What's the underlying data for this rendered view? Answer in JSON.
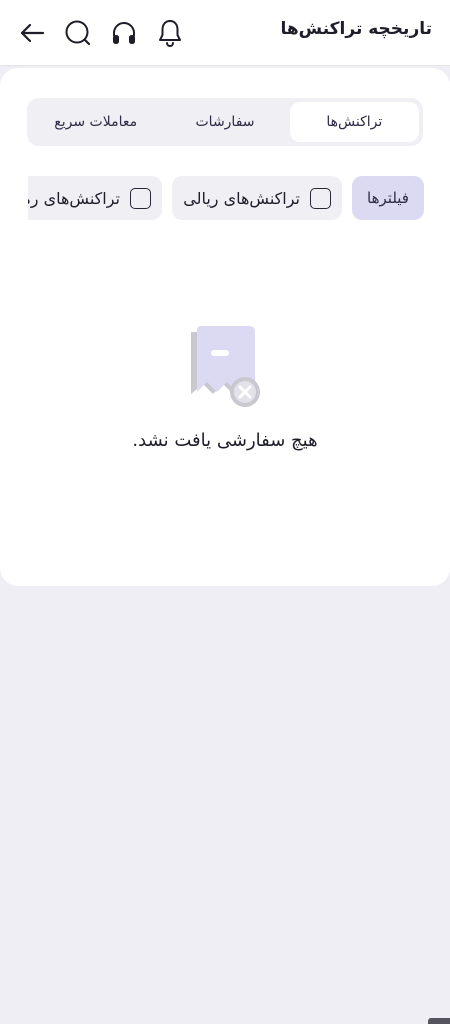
{
  "header": {
    "title": "تاریخچه تراکنش‌ها",
    "icons": [
      "back-arrow-icon",
      "search-icon",
      "headphones-icon",
      "bell-icon"
    ]
  },
  "tabs": [
    {
      "label": "تراکنش‌ها",
      "active": true
    },
    {
      "label": "سفارشات",
      "active": false
    },
    {
      "label": "معاملات سریع",
      "active": false
    }
  ],
  "filters": {
    "label": "فیلترها",
    "options": [
      {
        "label": "تراکنش‌های ریالی",
        "checked": false
      },
      {
        "label": "تراکنش‌های رمزارزی",
        "checked": false
      }
    ]
  },
  "empty_state": {
    "icon": "empty-receipt-icon",
    "message": "هیچ سفارشی یافت نشد."
  },
  "colors": {
    "background": "#efeef4",
    "surface": "#ffffff",
    "accent_chip": "#dcdaf3",
    "chip": "#f0eff4",
    "text": "#1e1e2a"
  }
}
